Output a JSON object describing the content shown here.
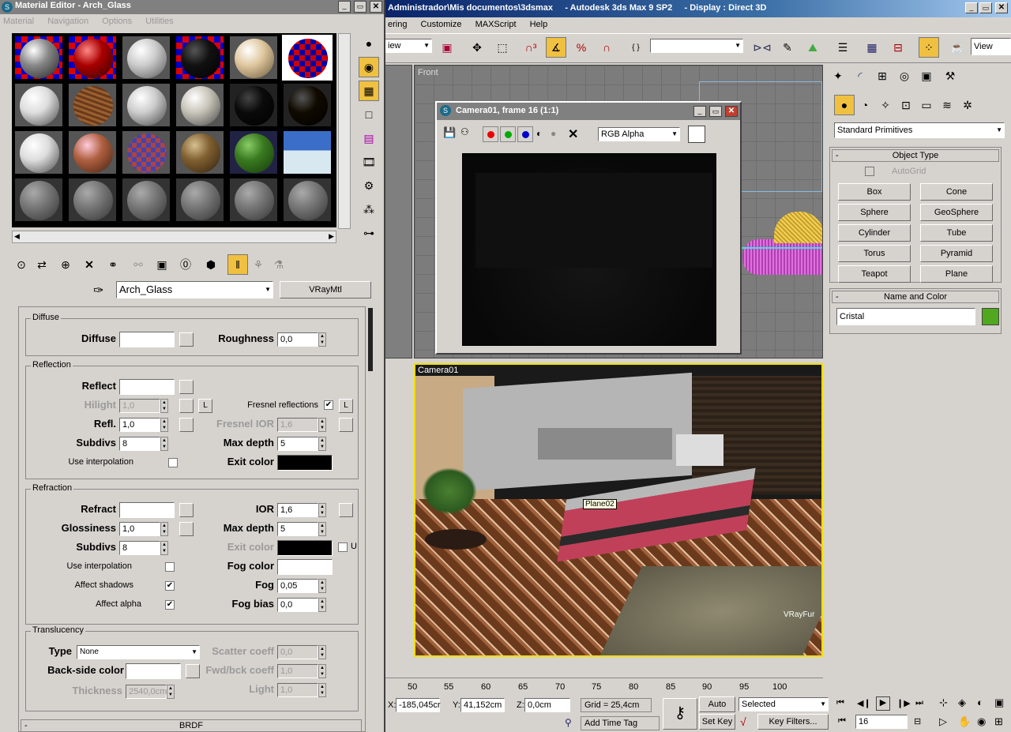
{
  "main_window": {
    "title": "Administrador\\Mis documentos\\3dsmax     - Autodesk 3ds Max 9 SP2     - Display : Direct 3D",
    "menu": [
      "ering",
      "Customize",
      "MAXScript",
      "Help"
    ],
    "view_dropdown": "iew",
    "view_label": "View"
  },
  "mat_editor": {
    "title": "Material Editor - Arch_Glass",
    "menu": [
      "Material",
      "Navigation",
      "Options",
      "Utilities"
    ],
    "material_name": "Arch_Glass",
    "material_type": "VRayMtl",
    "diffuse": {
      "group": "Diffuse",
      "diffuse_label": "Diffuse",
      "roughness_label": "Roughness",
      "roughness": "0,0"
    },
    "reflection": {
      "group": "Reflection",
      "reflect_label": "Reflect",
      "hilight_label": "Hilight",
      "hilight": "1,0",
      "refl_label": "Refl.",
      "refl": "1,0",
      "subdivs_label": "Subdivs",
      "subdivs": "8",
      "interp_label": "Use interpolation",
      "fresnel_label": "Fresnel reflections",
      "fresnel_ior_label": "Fresnel IOR",
      "fresnel_ior": "1,6",
      "maxdepth_label": "Max depth",
      "maxdepth": "5",
      "exit_label": "Exit color",
      "L": "L"
    },
    "refraction": {
      "group": "Refraction",
      "refract_label": "Refract",
      "gloss_label": "Glossiness",
      "gloss": "1,0",
      "subdivs_label": "Subdivs",
      "subdivs": "8",
      "interp_label": "Use interpolation",
      "shadows_label": "Affect shadows",
      "alpha_label": "Affect alpha",
      "ior_label": "IOR",
      "ior": "1,6",
      "maxdepth_label": "Max depth",
      "maxdepth": "5",
      "exit_label": "Exit color",
      "fogcolor_label": "Fog color",
      "fog_label": "Fog",
      "fog": "0,05",
      "fogbias_label": "Fog bias",
      "fogbias": "0,0",
      "U": "U"
    },
    "translucency": {
      "group": "Translucency",
      "type_label": "Type",
      "type_value": "None",
      "backside_label": "Back-side color",
      "thickness_label": "Thickness",
      "thickness": "2540,0cm",
      "scatter_label": "Scatter coeff",
      "scatter": "0,0",
      "fwd_label": "Fwd/bck coeff",
      "fwd": "1,0",
      "light_label": "Light",
      "light": "1,0"
    },
    "brdf_label": "BRDF"
  },
  "render_window": {
    "title": "Camera01, frame 16 (1:1)",
    "channel": "RGB Alpha"
  },
  "viewports": {
    "front_label": "Front",
    "camera_label": "Camera01",
    "object_label": "Plane02",
    "fur_label": "VRayFur"
  },
  "command_panel": {
    "category": "Standard Primitives",
    "object_type_title": "Object Type",
    "autogrid": "AutoGrid",
    "buttons": [
      "Box",
      "Cone",
      "Sphere",
      "GeoSphere",
      "Cylinder",
      "Tube",
      "Torus",
      "Pyramid",
      "Teapot",
      "Plane"
    ],
    "name_color_title": "Name and Color",
    "object_name": "Cristal",
    "object_color": "#4fa81e"
  },
  "timeline": {
    "ticks": [
      "50",
      "55",
      "60",
      "65",
      "70",
      "75",
      "80",
      "85",
      "90",
      "95",
      "100"
    ]
  },
  "status": {
    "x_label": "X:",
    "x": "-185,045cr",
    "y_label": "Y:",
    "y": "41,152cm",
    "z_label": "Z:",
    "z": "0,0cm",
    "grid": "Grid = 25,4cm",
    "add_time_tag": "Add Time Tag",
    "auto_key": "Auto Key",
    "set_key": "Set Key",
    "selected": "Selected",
    "key_filters": "Key Filters...",
    "frame": "16"
  }
}
